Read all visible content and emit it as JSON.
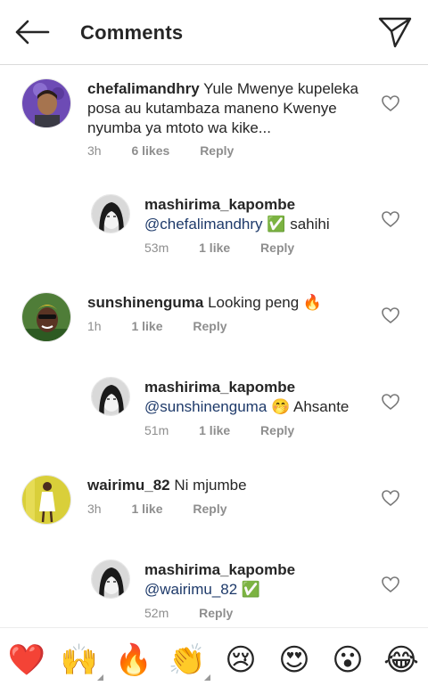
{
  "header": {
    "title": "Comments"
  },
  "comments": [
    {
      "username": "chefalimandhry",
      "text": "Yule Mwenye kupeleka posa au kutambaza maneno Kwenye nyumba ya mtoto wa kike...",
      "time": "3h",
      "likes": "6 likes",
      "reply": "Reply"
    },
    {
      "username": "mashirima_kapombe",
      "mention": "@chefalimandhry",
      "emoji": "✅",
      "text": "sahihi",
      "time": "53m",
      "likes": "1 like",
      "reply": "Reply"
    },
    {
      "username": "sunshinenguma",
      "text": "Looking peng",
      "emoji": "🔥",
      "time": "1h",
      "likes": "1 like",
      "reply": "Reply"
    },
    {
      "username": "mashirima_kapombe",
      "mention": "@sunshinenguma",
      "emoji": "🤭",
      "text": "Ahsante",
      "time": "51m",
      "likes": "1 like",
      "reply": "Reply"
    },
    {
      "username": "wairimu_82",
      "text": "Ni mjumbe",
      "time": "3h",
      "likes": "1 like",
      "reply": "Reply"
    },
    {
      "username": "mashirima_kapombe",
      "mention": "@wairimu_82",
      "emoji": "✅",
      "time": "52m",
      "reply": "Reply"
    }
  ],
  "emoji_bar": [
    "❤️",
    "🙌",
    "🔥",
    "👏",
    "😢",
    "😍",
    "😮",
    "😂"
  ],
  "colors": {
    "mention": "#1e3a6a",
    "meta": "#8e8e8e",
    "heart_red": "#e0245e"
  }
}
